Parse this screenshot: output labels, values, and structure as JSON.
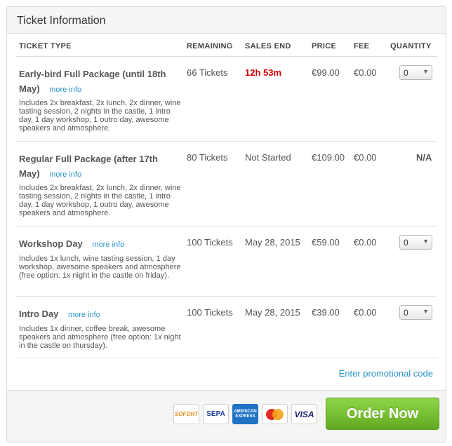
{
  "header": {
    "title": "Ticket Information"
  },
  "columns": {
    "ticket_type": "TICKET TYPE",
    "remaining": "REMAINING",
    "sales_end": "SALES END",
    "price": "PRICE",
    "fee": "FEE",
    "quantity": "QUANTITY"
  },
  "more_info_label": "more info",
  "tickets": [
    {
      "name_line1": "Early-bird Full Package (until 18th",
      "name_line2": "May)",
      "description": "Includes 2x breakfast, 2x lunch, 2x dinner, wine tasting session, 2 nights in the castle, 1 intro day, 1 day workshop, 1 outro day, awesome speakers and atmosphere.",
      "remaining": "66 Tickets",
      "sales_end": "12h 53m",
      "price": "€99.00",
      "fee": "€0.00",
      "quantity": "0"
    },
    {
      "name_line1": "Regular Full Package (after 17th",
      "name_line2": "May)",
      "description": "Includes 2x breakfast, 2x lunch, 2x dinner, wine tasting session, 2 nights in the castle, 1 intro day, 1 day workshop, 1 outro day, awesome speakers and atmosphere.",
      "remaining": "80 Tickets",
      "sales_end": "Not Started",
      "price": "€109.00",
      "fee": "€0.00",
      "quantity": "N/A"
    },
    {
      "name_line1": "Workshop Day",
      "description": "Includes 1x lunch, wine tasting session, 1 day workshop, awesome speakers and atmosphere (free option: 1x night in the castle on friday).",
      "remaining": "100 Tickets",
      "sales_end": "May 28, 2015",
      "price": "€59.00",
      "fee": "€0.00",
      "quantity": "0"
    },
    {
      "name_line1": "Intro Day",
      "description": "Includes 1x dinner, coffee break, awesome speakers and atmosphere (free option: 1x night in the castle on thursday).",
      "remaining": "100 Tickets",
      "sales_end": "May 28, 2015",
      "price": "€39.00",
      "fee": "€0.00",
      "quantity": "0"
    }
  ],
  "promo_link": "Enter promotional code",
  "payment": {
    "sofort": "SOFORT",
    "sepa": "SEPA",
    "amex": "AMERICAN EXPRESS",
    "visa": "VISA",
    "mastercard": "MasterCard",
    "icons": [
      "sofort-icon",
      "sepa-icon",
      "amex-icon",
      "mastercard-icon",
      "visa-icon"
    ]
  },
  "order_button": "Order Now",
  "colors": {
    "accent_link": "#2a94c9",
    "alert_red": "#d40000",
    "button_green": "#76c034"
  }
}
